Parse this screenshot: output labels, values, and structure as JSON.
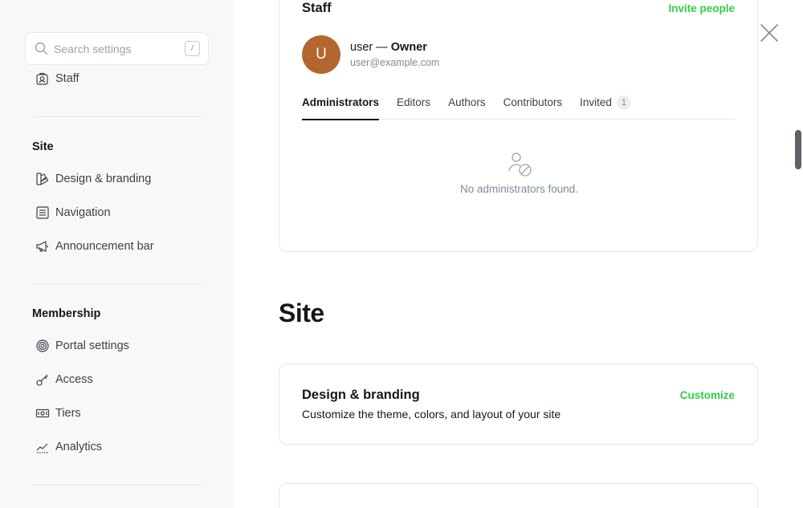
{
  "search": {
    "placeholder": "Search settings",
    "shortcut": "/"
  },
  "sidebar": {
    "top_item": {
      "label": "Staff",
      "icon": "staff-icon"
    },
    "sections": [
      {
        "title": "Site",
        "items": [
          {
            "label": "Design & branding",
            "icon": "brush-icon"
          },
          {
            "label": "Navigation",
            "icon": "list-icon"
          },
          {
            "label": "Announcement bar",
            "icon": "megaphone-icon"
          }
        ]
      },
      {
        "title": "Membership",
        "items": [
          {
            "label": "Portal settings",
            "icon": "portal-icon"
          },
          {
            "label": "Access",
            "icon": "key-icon"
          },
          {
            "label": "Tiers",
            "icon": "money-icon"
          },
          {
            "label": "Analytics",
            "icon": "chart-icon"
          }
        ]
      }
    ]
  },
  "staff": {
    "title": "Staff",
    "action": "Invite people",
    "owner": {
      "initial": "U",
      "name": "user",
      "separator": " — ",
      "role": "Owner",
      "email": "user@example.com"
    },
    "tabs": [
      {
        "label": "Administrators",
        "active": true
      },
      {
        "label": "Editors"
      },
      {
        "label": "Authors"
      },
      {
        "label": "Contributors"
      },
      {
        "label": "Invited",
        "count": "1"
      }
    ],
    "empty_text": "No administrators found."
  },
  "site": {
    "heading": "Site",
    "design": {
      "title": "Design & branding",
      "action": "Customize",
      "description": "Customize the theme, colors, and layout of your site"
    }
  },
  "colors": {
    "accent": "#30cf43",
    "avatar": "#b2672f",
    "sidebar_bg": "#f8f8f9"
  }
}
